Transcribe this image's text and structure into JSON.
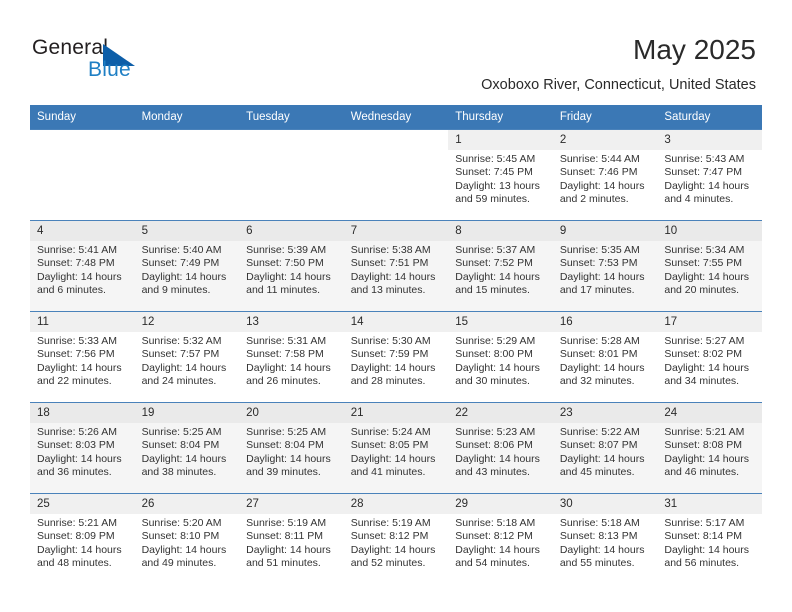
{
  "brand": {
    "name_part1": "General",
    "name_part2": "Blue",
    "triangle_icon": "triangle-logo-icon",
    "accent_color": "#0d5ea8",
    "text_color": "#1f7fc4"
  },
  "header": {
    "title": "May 2025",
    "location": "Oxoboxo River, Connecticut, United States"
  },
  "calendar": {
    "header_bg": "#3b78b5",
    "weekday_headers": [
      "Sunday",
      "Monday",
      "Tuesday",
      "Wednesday",
      "Thursday",
      "Friday",
      "Saturday"
    ],
    "weeks": [
      [
        {
          "day": "",
          "lines": []
        },
        {
          "day": "",
          "lines": []
        },
        {
          "day": "",
          "lines": []
        },
        {
          "day": "",
          "lines": []
        },
        {
          "day": "1",
          "lines": [
            "Sunrise: 5:45 AM",
            "Sunset: 7:45 PM",
            "Daylight: 13 hours",
            "and 59 minutes."
          ]
        },
        {
          "day": "2",
          "lines": [
            "Sunrise: 5:44 AM",
            "Sunset: 7:46 PM",
            "Daylight: 14 hours",
            "and 2 minutes."
          ]
        },
        {
          "day": "3",
          "lines": [
            "Sunrise: 5:43 AM",
            "Sunset: 7:47 PM",
            "Daylight: 14 hours",
            "and 4 minutes."
          ]
        }
      ],
      [
        {
          "day": "4",
          "lines": [
            "Sunrise: 5:41 AM",
            "Sunset: 7:48 PM",
            "Daylight: 14 hours",
            "and 6 minutes."
          ]
        },
        {
          "day": "5",
          "lines": [
            "Sunrise: 5:40 AM",
            "Sunset: 7:49 PM",
            "Daylight: 14 hours",
            "and 9 minutes."
          ]
        },
        {
          "day": "6",
          "lines": [
            "Sunrise: 5:39 AM",
            "Sunset: 7:50 PM",
            "Daylight: 14 hours",
            "and 11 minutes."
          ]
        },
        {
          "day": "7",
          "lines": [
            "Sunrise: 5:38 AM",
            "Sunset: 7:51 PM",
            "Daylight: 14 hours",
            "and 13 minutes."
          ]
        },
        {
          "day": "8",
          "lines": [
            "Sunrise: 5:37 AM",
            "Sunset: 7:52 PM",
            "Daylight: 14 hours",
            "and 15 minutes."
          ]
        },
        {
          "day": "9",
          "lines": [
            "Sunrise: 5:35 AM",
            "Sunset: 7:53 PM",
            "Daylight: 14 hours",
            "and 17 minutes."
          ]
        },
        {
          "day": "10",
          "lines": [
            "Sunrise: 5:34 AM",
            "Sunset: 7:55 PM",
            "Daylight: 14 hours",
            "and 20 minutes."
          ]
        }
      ],
      [
        {
          "day": "11",
          "lines": [
            "Sunrise: 5:33 AM",
            "Sunset: 7:56 PM",
            "Daylight: 14 hours",
            "and 22 minutes."
          ]
        },
        {
          "day": "12",
          "lines": [
            "Sunrise: 5:32 AM",
            "Sunset: 7:57 PM",
            "Daylight: 14 hours",
            "and 24 minutes."
          ]
        },
        {
          "day": "13",
          "lines": [
            "Sunrise: 5:31 AM",
            "Sunset: 7:58 PM",
            "Daylight: 14 hours",
            "and 26 minutes."
          ]
        },
        {
          "day": "14",
          "lines": [
            "Sunrise: 5:30 AM",
            "Sunset: 7:59 PM",
            "Daylight: 14 hours",
            "and 28 minutes."
          ]
        },
        {
          "day": "15",
          "lines": [
            "Sunrise: 5:29 AM",
            "Sunset: 8:00 PM",
            "Daylight: 14 hours",
            "and 30 minutes."
          ]
        },
        {
          "day": "16",
          "lines": [
            "Sunrise: 5:28 AM",
            "Sunset: 8:01 PM",
            "Daylight: 14 hours",
            "and 32 minutes."
          ]
        },
        {
          "day": "17",
          "lines": [
            "Sunrise: 5:27 AM",
            "Sunset: 8:02 PM",
            "Daylight: 14 hours",
            "and 34 minutes."
          ]
        }
      ],
      [
        {
          "day": "18",
          "lines": [
            "Sunrise: 5:26 AM",
            "Sunset: 8:03 PM",
            "Daylight: 14 hours",
            "and 36 minutes."
          ]
        },
        {
          "day": "19",
          "lines": [
            "Sunrise: 5:25 AM",
            "Sunset: 8:04 PM",
            "Daylight: 14 hours",
            "and 38 minutes."
          ]
        },
        {
          "day": "20",
          "lines": [
            "Sunrise: 5:25 AM",
            "Sunset: 8:04 PM",
            "Daylight: 14 hours",
            "and 39 minutes."
          ]
        },
        {
          "day": "21",
          "lines": [
            "Sunrise: 5:24 AM",
            "Sunset: 8:05 PM",
            "Daylight: 14 hours",
            "and 41 minutes."
          ]
        },
        {
          "day": "22",
          "lines": [
            "Sunrise: 5:23 AM",
            "Sunset: 8:06 PM",
            "Daylight: 14 hours",
            "and 43 minutes."
          ]
        },
        {
          "day": "23",
          "lines": [
            "Sunrise: 5:22 AM",
            "Sunset: 8:07 PM",
            "Daylight: 14 hours",
            "and 45 minutes."
          ]
        },
        {
          "day": "24",
          "lines": [
            "Sunrise: 5:21 AM",
            "Sunset: 8:08 PM",
            "Daylight: 14 hours",
            "and 46 minutes."
          ]
        }
      ],
      [
        {
          "day": "25",
          "lines": [
            "Sunrise: 5:21 AM",
            "Sunset: 8:09 PM",
            "Daylight: 14 hours",
            "and 48 minutes."
          ]
        },
        {
          "day": "26",
          "lines": [
            "Sunrise: 5:20 AM",
            "Sunset: 8:10 PM",
            "Daylight: 14 hours",
            "and 49 minutes."
          ]
        },
        {
          "day": "27",
          "lines": [
            "Sunrise: 5:19 AM",
            "Sunset: 8:11 PM",
            "Daylight: 14 hours",
            "and 51 minutes."
          ]
        },
        {
          "day": "28",
          "lines": [
            "Sunrise: 5:19 AM",
            "Sunset: 8:12 PM",
            "Daylight: 14 hours",
            "and 52 minutes."
          ]
        },
        {
          "day": "29",
          "lines": [
            "Sunrise: 5:18 AM",
            "Sunset: 8:12 PM",
            "Daylight: 14 hours",
            "and 54 minutes."
          ]
        },
        {
          "day": "30",
          "lines": [
            "Sunrise: 5:18 AM",
            "Sunset: 8:13 PM",
            "Daylight: 14 hours",
            "and 55 minutes."
          ]
        },
        {
          "day": "31",
          "lines": [
            "Sunrise: 5:17 AM",
            "Sunset: 8:14 PM",
            "Daylight: 14 hours",
            "and 56 minutes."
          ]
        }
      ]
    ]
  }
}
